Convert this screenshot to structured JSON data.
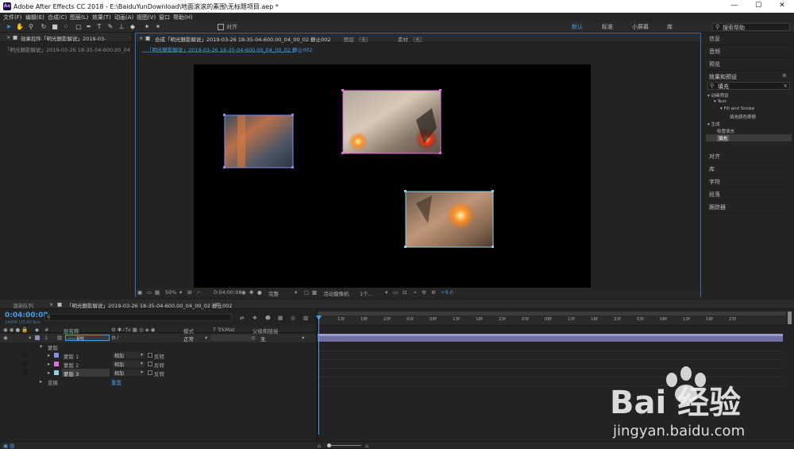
{
  "titlebar": {
    "app_icon": "Ae",
    "title": "Adobe After Effects CC 2018 - E:\\BaiduYunDownload\\地面滚滚的素围\\无标题项目.aep *",
    "minimize": "—",
    "maximize": "☐",
    "close": "✕"
  },
  "menu": [
    "文件(F)",
    "编辑(E)",
    "合成(C)",
    "图层(L)",
    "效果(T)",
    "动画(A)",
    "视图(V)",
    "窗口",
    "帮助(H)"
  ],
  "toolbar": {
    "align_label": "对齐",
    "workspaces": [
      "默认",
      "标准",
      "小屏幕",
      "库"
    ],
    "search_placeholder": "搜索帮助"
  },
  "effect_controls": {
    "tab_label": "效果控件「明光魅影解说」2019-03-",
    "layer_path": "「明光魅影解说」2019-03-26 18-35-04-600.00_04_00_02 静止002"
  },
  "composition": {
    "tab_label": "合成「明光魅影解说」2019-03-26 18-35-04-600.00_04_00_02 静止002",
    "layer_tab": "图层 （无）",
    "footage_tab": "素材 （无）",
    "breadcrumb": "「明光魅影解说」2019-03-26 18-35-04-600.00_04_00_02 静止002",
    "zoom": "50%",
    "timecode": "0:04:00:08",
    "quality": "完整",
    "camera": "活动摄像机",
    "views": "1个...",
    "exposure": "+0.0"
  },
  "right_panels": {
    "top": [
      "信息",
      "音频",
      "预览"
    ],
    "effects_presets": {
      "title": "效果和预设",
      "search_value": "填充",
      "tree": [
        "▾ 动画预设",
        "▾ Text",
        "▾ Fill and Stroke",
        "填充颜色摩擦",
        "▾ 生成",
        "吸管填充",
        "填充"
      ]
    },
    "bottom": [
      "对齐",
      "库",
      "字符",
      "段落",
      "跟踪器"
    ]
  },
  "timeline": {
    "render_queue_tab": "渲染队列",
    "comp_tab": "「明光魅影解说」2019-03-26 18-35-04-600.00_04_00_02 静止002",
    "timecode": "0:04:00:08",
    "frame_info": "14408 (25.00 fps)",
    "columns": {
      "name": "层名称",
      "mode": "模式",
      "trkmat": "T TrkMat",
      "parent": "父级和链接"
    },
    "layer": {
      "index": "1",
      "name": "......jpg",
      "mode": "正常",
      "parent": "无"
    },
    "mask_group": "蒙版",
    "masks": [
      {
        "name": "蒙版 1",
        "mode": "相加",
        "invert": "反转",
        "color": "#8a8cf0"
      },
      {
        "name": "蒙版 2",
        "mode": "相加",
        "invert": "反转",
        "color": "#e070d8"
      },
      {
        "name": "蒙版 3",
        "mode": "相加",
        "invert": "反转",
        "color": "#8fd0e8"
      }
    ],
    "transform": "变换",
    "transform_reset": "重置",
    "ruler_labels": [
      "13f",
      "18f",
      "23f",
      "03f",
      "08f",
      "13f",
      "18f",
      "23f",
      "03f",
      "08f",
      "13f",
      "18f",
      "23f",
      "03f",
      "08f",
      "13f",
      "18f",
      "23f"
    ]
  },
  "watermark": {
    "logo": "Bai 经验",
    "url": "jingyan.baidu.com"
  },
  "colors": {
    "accent": "#4a9be8",
    "panel_bg": "#232323",
    "timecode": "#4a9be8"
  }
}
